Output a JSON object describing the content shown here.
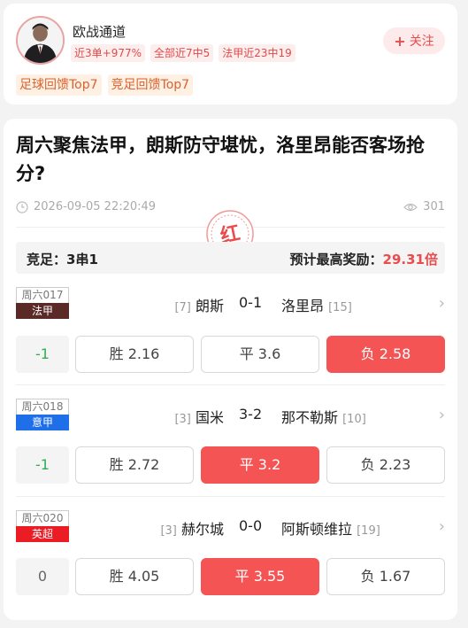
{
  "author": {
    "name": "欧战通道",
    "stats": [
      "近3单+977%",
      "全部近7中5",
      "法甲近23中19"
    ],
    "honors": [
      "足球回馈Top7",
      "竞足回馈Top7"
    ],
    "follow_label": "关注"
  },
  "article": {
    "title": "周六聚焦法甲，朗斯防守堪忧，洛里昂能否客场抢分?",
    "time": "2026-09-05 22:20:49",
    "views": "301",
    "result_stamp": "红"
  },
  "summary": {
    "play_type_label": "竞足：",
    "play_type_value": "3串1",
    "max_prize_label": "预计最高奖励：",
    "max_prize_value": "29.31倍"
  },
  "matches": [
    {
      "no": "周六017",
      "league": "法甲",
      "league_color": "#5a2a27",
      "home_rank": "[7]",
      "home": "朗斯",
      "score": "0-1",
      "away": "洛里昂",
      "away_rank": "[15]",
      "handicap": "-1",
      "handicap_color": "#2fae4f",
      "win": "胜 2.16",
      "draw": "平 3.6",
      "lose": "负 2.58",
      "selected": "lose"
    },
    {
      "no": "周六018",
      "league": "意甲",
      "league_color": "#1e6fe8",
      "home_rank": "[3]",
      "home": "国米",
      "score": "3-2",
      "away": "那不勒斯",
      "away_rank": "[10]",
      "handicap": "-1",
      "handicap_color": "#2fae4f",
      "win": "胜 2.72",
      "draw": "平 3.2",
      "lose": "负 2.23",
      "selected": "draw"
    },
    {
      "no": "周六020",
      "league": "英超",
      "league_color": "#ea1c24",
      "home_rank": "[3]",
      "home": "赫尔城",
      "score": "0-0",
      "away": "阿斯顿维拉",
      "away_rank": "[19]",
      "handicap": "0",
      "handicap_color": "#666666",
      "win": "胜 4.05",
      "draw": "平 3.55",
      "lose": "负 1.67",
      "selected": "draw"
    }
  ],
  "icons": {
    "avatar": "person-avatar",
    "clock": "clock-icon",
    "eye": "eye-icon",
    "arrow": "chevron-right-icon",
    "follow": "plus-icon"
  },
  "colors": {
    "accent_red": "#f45454",
    "tag_red": "#e24a4a",
    "honor_orange": "#d9612e"
  }
}
